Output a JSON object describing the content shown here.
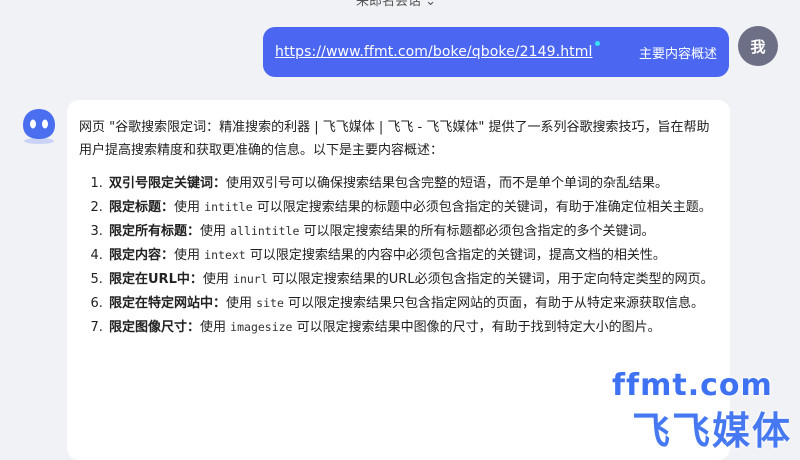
{
  "top_hint": "来郎名会话 ⌄",
  "user_message": {
    "link": "https://www.ffmt.com/boke/qboke/2149.html",
    "summary": "主要内容概述"
  },
  "user_avatar": "我",
  "bot_reply": {
    "intro": "网页 \"谷歌搜索限定词：精准搜索的利器 | 飞飞媒体 | 飞飞 - 飞飞媒体\" 提供了一系列谷歌搜索技巧，旨在帮助用户提高搜索精度和获取更准确的信息。以下是主要内容概述：",
    "points": [
      {
        "title": "双引号限定关键词",
        "sep": "：",
        "pre": "使用双引号可以确保搜索结果包含完整的短语，而不是单个单词的杂乱结果。",
        "code": "",
        "post": ""
      },
      {
        "title": "限定标题",
        "sep": "：",
        "pre": "使用 ",
        "code": "intitle",
        "post": " 可以限定搜索结果的标题中必须包含指定的关键词，有助于准确定位相关主题。"
      },
      {
        "title": "限定所有标题",
        "sep": "：",
        "pre": "使用 ",
        "code": "allintitle",
        "post": " 可以限定搜索结果的所有标题都必须包含指定的多个关键词。"
      },
      {
        "title": "限定内容",
        "sep": "：",
        "pre": "使用 ",
        "code": "intext",
        "post": " 可以限定搜索结果的内容中必须包含指定的关键词，提高文档的相关性。"
      },
      {
        "title": "限定在URL中",
        "sep": "：",
        "pre": "使用 ",
        "code": "inurl",
        "post": " 可以限定搜索结果的URL必须包含指定的关键词，用于定向特定类型的网页。"
      },
      {
        "title": "限定在特定网站中",
        "sep": "：",
        "pre": "使用 ",
        "code": "site",
        "post": " 可以限定搜索结果只包含指定网站的页面，有助于从特定来源获取信息。"
      },
      {
        "title": "限定图像尺寸",
        "sep": "：",
        "pre": "使用 ",
        "code": "imagesize",
        "post": " 可以限定搜索结果中图像的尺寸，有助于找到特定大小的图片。"
      }
    ]
  },
  "watermark": {
    "url": "ffmt.com",
    "name": "飞飞媒体"
  },
  "colors": {
    "user_bubble": "#4b67f2",
    "background": "#f1f2f6",
    "bot_avatar": "#4a6ef0"
  }
}
